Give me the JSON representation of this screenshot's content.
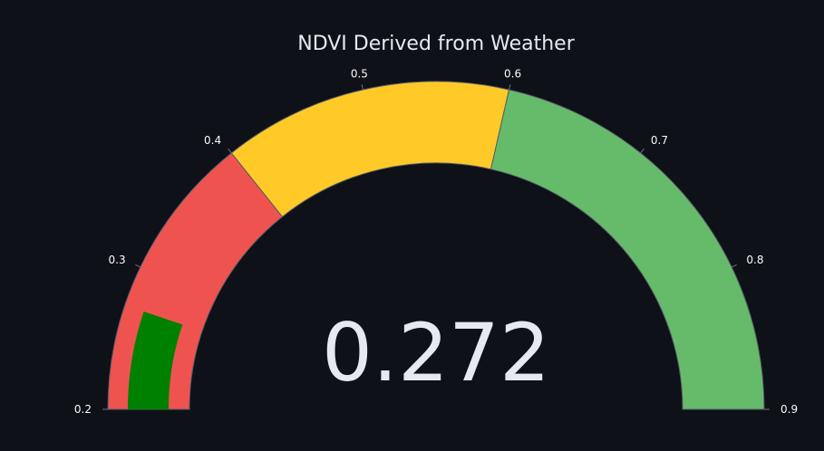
{
  "chart_data": {
    "type": "gauge",
    "title": "NDVI Derived from Weather",
    "value": 0.272,
    "value_text": "0.272",
    "range": [
      0.2,
      0.9
    ],
    "ticks": [
      0.2,
      0.3,
      0.4,
      0.5,
      0.6,
      0.7,
      0.8,
      0.9
    ],
    "tick_labels": [
      "0.2",
      "0.3",
      "0.4",
      "0.5",
      "0.6",
      "0.7",
      "0.8",
      "0.9"
    ],
    "steps": [
      {
        "range": [
          0.2,
          0.4
        ],
        "color": "#ef5350"
      },
      {
        "range": [
          0.4,
          0.6
        ],
        "color": "#ffca28"
      },
      {
        "range": [
          0.6,
          0.9
        ],
        "color": "#66bb6a"
      }
    ],
    "bar_color": "#008000",
    "background_color": "#0e1117",
    "text_color": "#e6e9ef"
  }
}
